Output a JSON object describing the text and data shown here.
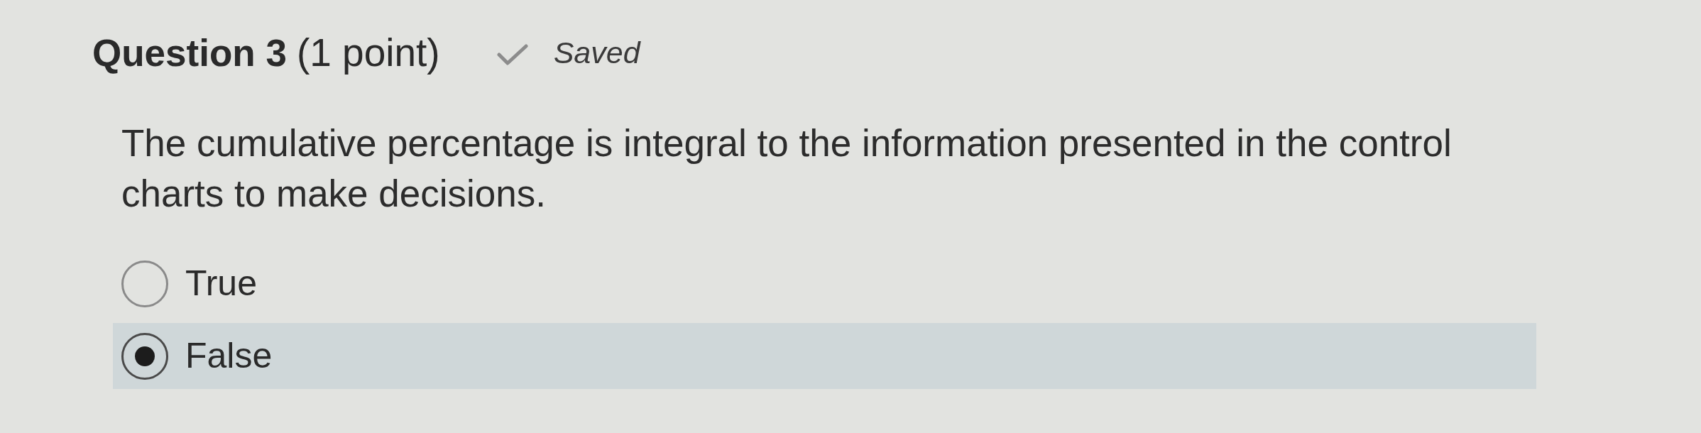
{
  "question": {
    "title": "Question 3",
    "points": "(1 point)",
    "status": "Saved"
  },
  "prompt": "The cumulative percentage is integral to the information presented in the control charts to make decisions.",
  "options": [
    {
      "label": "True",
      "selected": false
    },
    {
      "label": "False",
      "selected": true
    }
  ]
}
